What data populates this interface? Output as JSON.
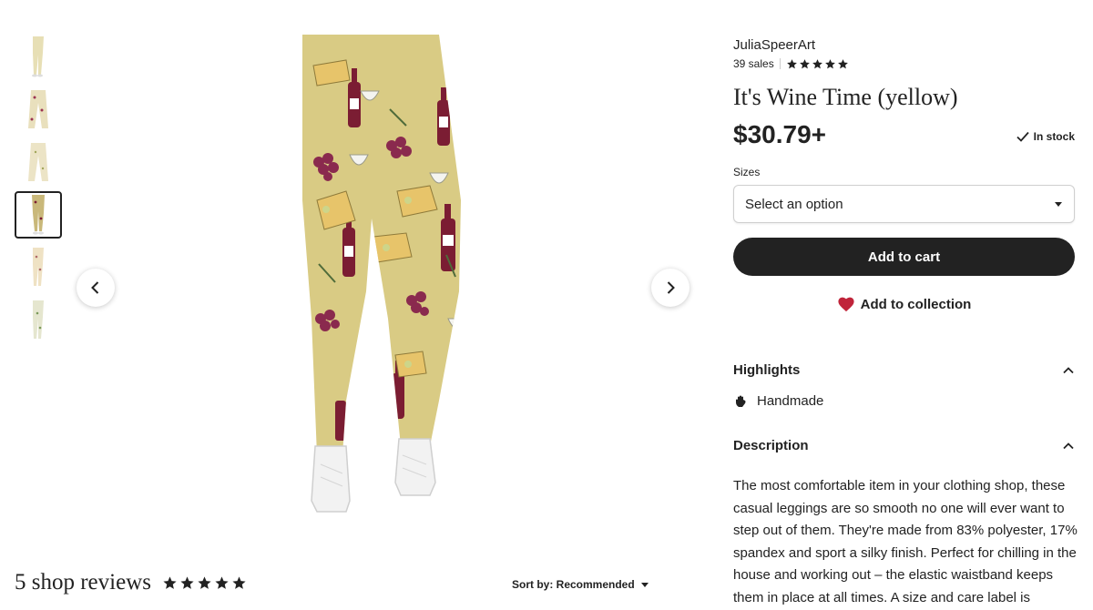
{
  "gallery": {
    "thumbnails": [
      {
        "label": "thumbnail-1"
      },
      {
        "label": "thumbnail-2"
      },
      {
        "label": "thumbnail-3"
      },
      {
        "label": "thumbnail-4",
        "active": true
      },
      {
        "label": "thumbnail-5"
      },
      {
        "label": "thumbnail-6"
      }
    ],
    "colors": {
      "fabric": "#d9cb84",
      "wine": "#7b1d33",
      "grape": "#8a2a4e",
      "shoe": "#f2f2f2",
      "leaf": "#4f6b3a"
    }
  },
  "reviews": {
    "title": "5 shop reviews",
    "rating_stars": 5,
    "sort_label": "Sort by: Recommended"
  },
  "product": {
    "shop_name": "JuliaSpeerArt",
    "sales": "39 sales",
    "shop_rating_stars": 5,
    "title": "It's Wine Time (yellow)",
    "price": "$30.79+",
    "stock_status": "In stock",
    "sizes_label": "Sizes",
    "sizes_select_value": "Select an option",
    "add_to_cart_label": "Add to cart",
    "add_to_collection_label": "Add to collection",
    "highlights_label": "Highlights",
    "highlight_items": [
      "Handmade"
    ],
    "description_label": "Description",
    "description_text": "The most comfortable item in your clothing shop, these casual leggings are so smooth no one will ever want to step out of them. They're made from 83% polyester, 17% spandex and sport a silky finish. Perfect for chilling in the house and working out – the elastic waistband keeps them in place at all times. A size and care label is"
  },
  "colors": {
    "text": "#222222",
    "button_bg": "#222222",
    "heart": "#c0243a",
    "border": "#cfcfcf"
  }
}
